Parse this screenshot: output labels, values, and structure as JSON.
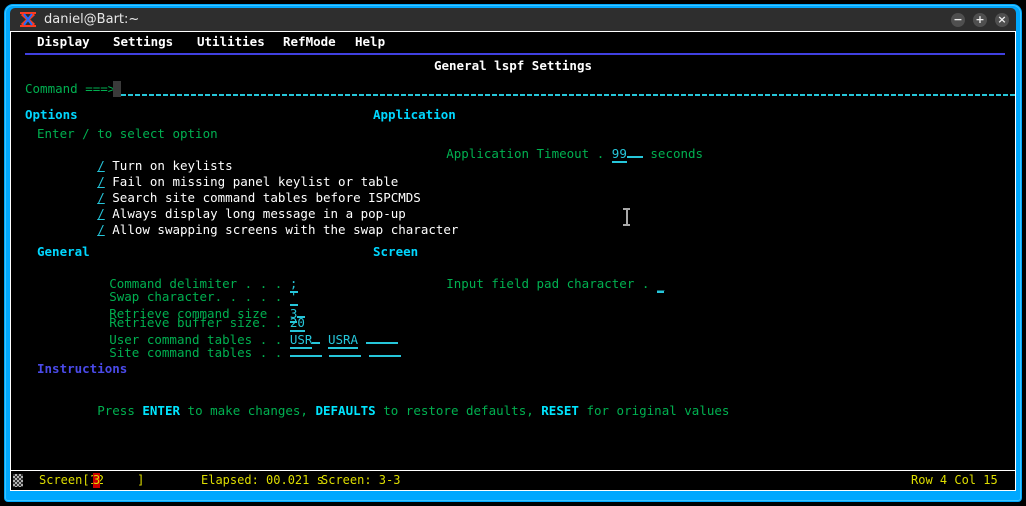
{
  "window": {
    "title": "daniel@Bart:~",
    "icon": "xterm-icon",
    "frame_color": "#00a8ff",
    "titlebar_color": "#2e2e2e",
    "controls": {
      "minimize": "−",
      "maximize": "+",
      "close": "×"
    }
  },
  "menubar": {
    "items": [
      {
        "label": "Display"
      },
      {
        "label": "Settings"
      },
      {
        "label": "Utilities"
      },
      {
        "label": "RefMode"
      },
      {
        "label": "Help"
      }
    ]
  },
  "panel": {
    "title": "General lspf Settings",
    "separator_color": "#4040e0"
  },
  "command_line": {
    "label": "Command ===>",
    "value": "",
    "placeholder": ""
  },
  "sections": {
    "options": {
      "heading": "Options",
      "hint": "Enter / to select option",
      "items": [
        {
          "mark": "/",
          "label": "Turn on keylists"
        },
        {
          "mark": "/",
          "label": "Fail on missing panel keylist or table"
        },
        {
          "mark": "/",
          "label": "Search site command tables before ISPCMDS"
        },
        {
          "mark": "/",
          "label": "Always display long message in a pop-up"
        },
        {
          "mark": "/",
          "label": "Allow swapping screens with the swap character"
        }
      ]
    },
    "application": {
      "heading": "Application",
      "timeout": {
        "label": "Application Timeout .",
        "value": "99",
        "pad": "__",
        "units": "seconds"
      }
    },
    "general": {
      "heading": "General",
      "fields": [
        {
          "label": "Command delimiter . . .",
          "value": ";",
          "width": 1
        },
        {
          "label": "Swap character. . . . .",
          "value": "'",
          "width": 1
        },
        {
          "label": "Retrieve command size .",
          "value": "3",
          "width": 2
        },
        {
          "label": "Retrieve buffer size. .",
          "value": "20",
          "width": 2
        }
      ],
      "user_command_tables": {
        "label": "User command tables . .",
        "values": [
          "USR",
          "USRA",
          ""
        ]
      },
      "site_command_tables": {
        "label": "Site command tables . .",
        "values": [
          "",
          "",
          ""
        ]
      }
    },
    "screen": {
      "heading": "Screen",
      "pad_character": {
        "label": "Input field pad character .",
        "value": "_"
      }
    },
    "instructions": {
      "heading": "Instructions",
      "text_parts": [
        {
          "text": "Press ",
          "style": "normal"
        },
        {
          "text": "ENTER",
          "style": "key"
        },
        {
          "text": " to make changes, ",
          "style": "normal"
        },
        {
          "text": "DEFAULTS",
          "style": "key"
        },
        {
          "text": " to restore defaults, ",
          "style": "normal"
        },
        {
          "text": "RESET",
          "style": "key"
        },
        {
          "text": " for original values",
          "style": "normal"
        }
      ],
      "full_text": "Press ENTER to make changes, DEFAULTS to restore defaults, RESET for original values"
    }
  },
  "statusbar": {
    "screen_list_prefix": "Screen[12",
    "screen_list_current": "3",
    "screen_list_suffix": "     ]",
    "elapsed": "Elapsed: 00.021 s",
    "screen": "Screen: 3-3",
    "cursor_position": "Row 4 Col 15",
    "text_color": "#dede00",
    "highlight_color": "#cc0000"
  }
}
